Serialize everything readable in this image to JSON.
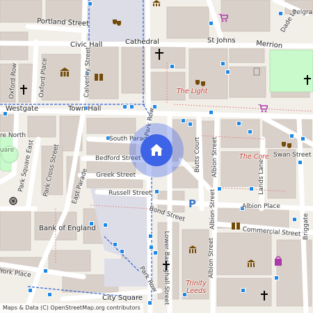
{
  "map": {
    "attribution": "Maps & Data (C) OpenStreetMap.org contributors",
    "streets": {
      "portland_street": "Portland Street",
      "civic_hall": "Civic Hall",
      "cathedral": "Cathedral",
      "st_johns": "St Johns",
      "merrion": "Merrion",
      "belgrave": "Belgra",
      "westgate": "Westgate",
      "town_hall": "Town Hall",
      "south_parade": "South Parade",
      "bedford_street": "Bedford Street",
      "greek_street": "Greek Street",
      "russell_street": "Russell Street",
      "bond_street": "Bond Street",
      "albion_place": "Albion Place",
      "commercial_street": "Commercial Street",
      "swan_street": "Swan Street",
      "butts_court": "Butts Court",
      "albion_street_1": "Albion Street",
      "albion_street_2": "Albion Street",
      "albion_street_3": "Albion Street",
      "lands_lane": "Lands Lane",
      "briggate": "Briggate",
      "park_row": "Park Row",
      "oxford_row": "Oxford Row",
      "oxford_place": "Oxford Place",
      "calverley_street": "Calverley Street",
      "park_square_north": "re North",
      "park_square_east": "Park Square East",
      "park_cross_street": "Park Cross Street",
      "east_parade": "East Parade",
      "lower_basinghall_street": "Lower Basinghall Street",
      "york_place": "York Place",
      "city_square": "City Square",
      "bank_of_england": "Bank of England",
      "park_row_lower": "Park Row",
      "square_park": "uare"
    },
    "places": {
      "the_light": "The Light",
      "the_core": "The Core",
      "trinity_leeds": "Trinity Leeds",
      "dade_lane": "Dade La"
    },
    "colors": {
      "background": "#f2efe9",
      "building": "#d9d0c9",
      "road": "#ffffff",
      "pedestrian": "#dddde8",
      "park": "#c8facc",
      "marker": "#3d63e6",
      "bus_stop": "#1e88e5",
      "poi_text": "#c0392b"
    },
    "icons": [
      "theatre-icon",
      "church-icon",
      "museum-icon",
      "library-icon",
      "shop-icon",
      "parking-icon",
      "bus-stop-icon",
      "current-location-icon"
    ]
  }
}
